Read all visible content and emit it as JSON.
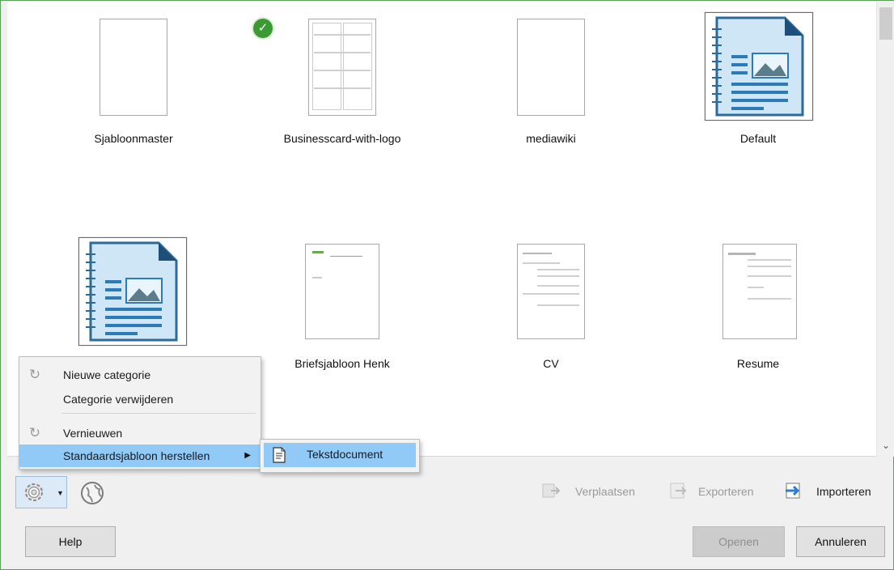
{
  "templates": {
    "row1": [
      {
        "label": "Sjabloonmaster"
      },
      {
        "label": "Businesscard-with-logo"
      },
      {
        "label": "mediawiki"
      },
      {
        "label": "Default"
      }
    ],
    "row2": [
      {
        "label": "Briefsjabloon Henk"
      },
      {
        "label": "CV"
      },
      {
        "label": "Resume"
      }
    ]
  },
  "context_menu": {
    "items": [
      {
        "label": "Nieuwe categorie",
        "icon": "refresh-icon"
      },
      {
        "label": "Categorie verwijderen"
      },
      {
        "label": "Vernieuwen",
        "icon": "refresh-icon"
      },
      {
        "label": "Standaardsjabloon herstellen",
        "icon": "submenu-arrow"
      }
    ],
    "submenu": {
      "label": "Tekstdocument",
      "icon": "text-document-icon"
    }
  },
  "toolbar": {
    "move_label": "Verplaatsen",
    "export_label": "Exporteren",
    "import_label": "Importeren"
  },
  "buttons": {
    "help": "Help",
    "open": "Openen",
    "cancel": "Annuleren"
  },
  "colors": {
    "highlight": "#91c9f7",
    "check_green": "#3c9a33",
    "frame_border": "#5aa05a"
  }
}
